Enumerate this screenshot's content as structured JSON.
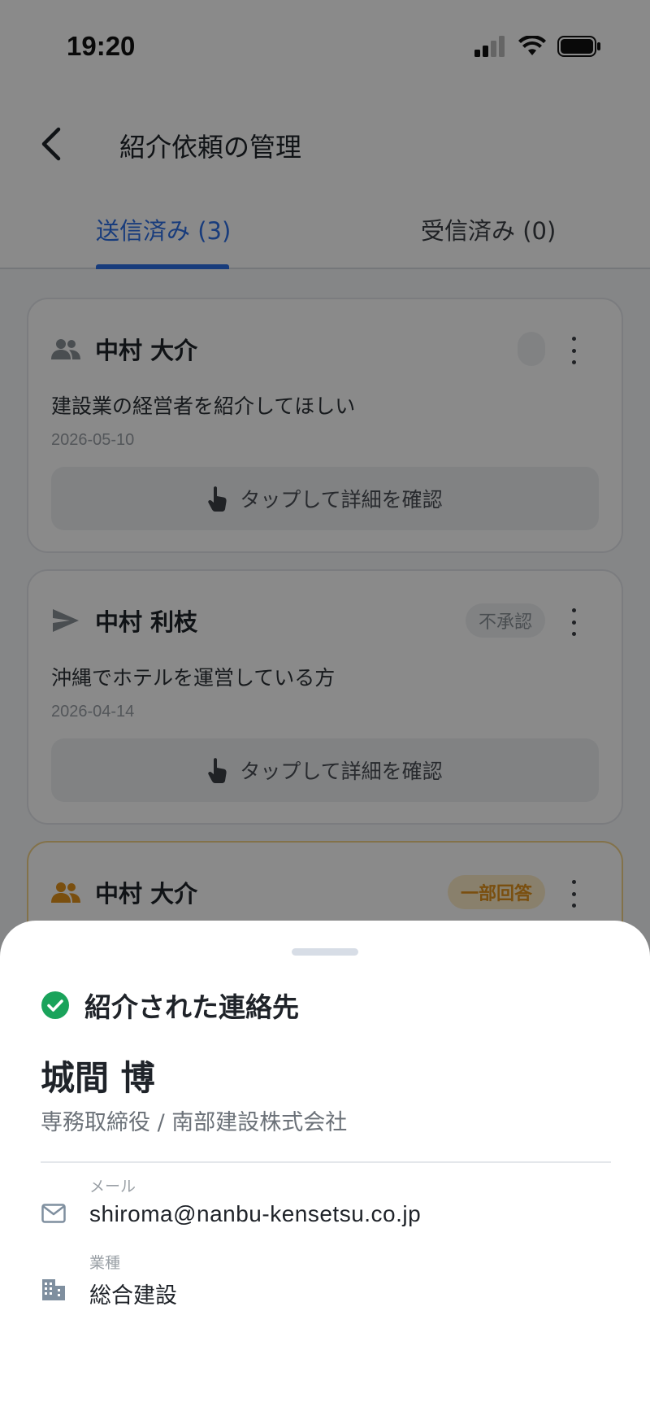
{
  "status_bar": {
    "time": "19:20"
  },
  "header": {
    "title": "紹介依頼の管理"
  },
  "tabs": [
    {
      "label": "送信済み (3)"
    },
    {
      "label": "受信済み (0)"
    }
  ],
  "cards": [
    {
      "name": "中村 大介",
      "icon": "people-icon",
      "badge": "",
      "description": "建設業の経営者を紹介してほしい",
      "date": "2026-05-10",
      "action": "タップして詳細を確認"
    },
    {
      "name": "中村 利枝",
      "icon": "send-icon",
      "badge": "不承認",
      "description": "沖縄でホテルを運営している方",
      "date": "2026-04-14",
      "action": "タップして詳細を確認"
    },
    {
      "name": "中村 大介",
      "icon": "people-icon",
      "badge": "一部回答"
    }
  ],
  "sheet": {
    "title": "紹介された連絡先",
    "contact_name": "城間 博",
    "contact_role": "専務取締役 / 南部建設株式会社",
    "email_label": "メール",
    "email_value": "shiroma@nanbu-kensetsu.co.jp",
    "industry_label": "業種",
    "industry_value": "総合建設"
  },
  "colors": {
    "accent": "#2e6fe6",
    "success": "#1aa35b",
    "warning": "#e2931c"
  }
}
